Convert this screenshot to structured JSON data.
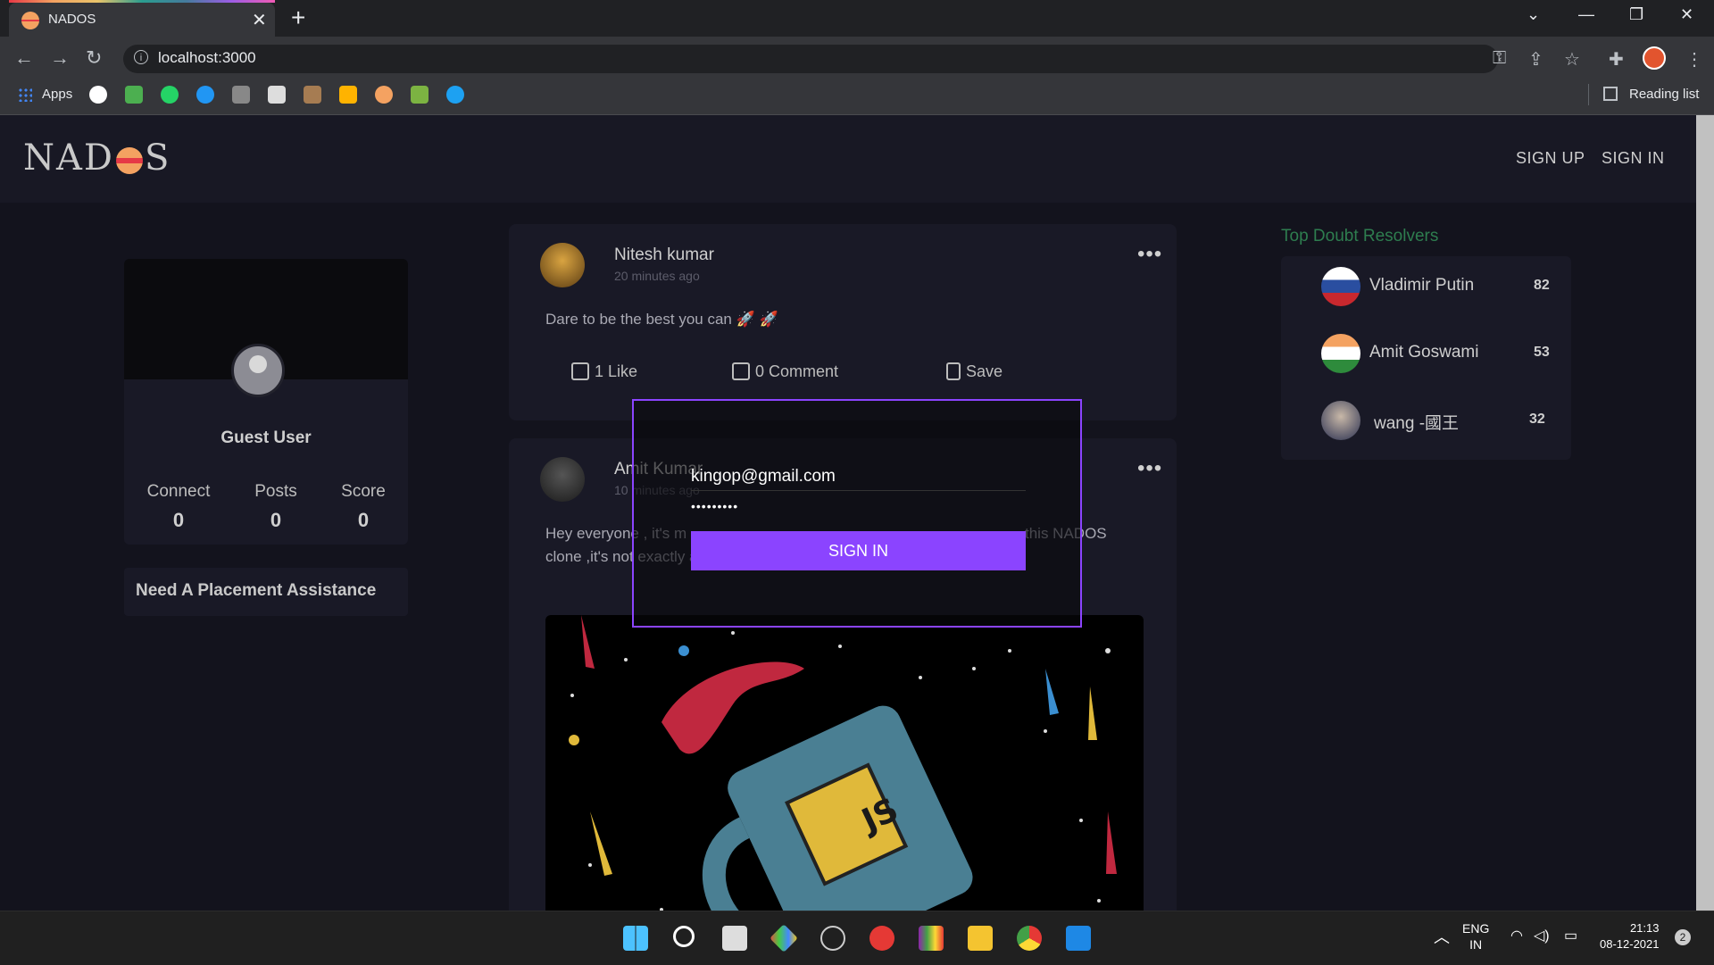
{
  "browser": {
    "tab_title": "NADOS",
    "url": "localhost:3000",
    "apps_label": "Apps",
    "reading_list": "Reading list",
    "win_minimize": "—",
    "win_restore": "❐",
    "win_close": "✕",
    "new_tab": "+",
    "tab_close": "✕"
  },
  "nav": {
    "logo": "NADOS",
    "sign_up": "SIGN UP",
    "sign_in": "SIGN IN"
  },
  "profile": {
    "name": "Guest User",
    "stats": [
      {
        "label": "Connect",
        "value": "0"
      },
      {
        "label": "Posts",
        "value": "0"
      },
      {
        "label": "Score",
        "value": "0"
      }
    ],
    "placement": "Need A Placement Assistance"
  },
  "posts": [
    {
      "author": "Nitesh kumar",
      "time": "20 minutes ago",
      "text": "Dare to be the best you can 🚀 🚀",
      "like": "1 Like",
      "comment": "0 Comment",
      "save": "Save"
    },
    {
      "author": "Amit Kumar",
      "time": "10 minutes ago",
      "text_line1": "Hey everyone , it's m",
      "text_line1b": "this NADOS",
      "text_line2": "clone ,it's not exactly as same as original one but i tried ... 🚀 🚀",
      "image_label": "JS"
    }
  ],
  "resolvers": {
    "title": "Top Doubt Resolvers",
    "items": [
      {
        "name": "Vladimir Putin",
        "score": "82"
      },
      {
        "name": "Amit Goswami",
        "score": "53"
      },
      {
        "name": "wang -國王",
        "score": "32"
      }
    ]
  },
  "modal": {
    "email": "kingop@gmail.com",
    "password_mask": "•••••••••",
    "button": "SIGN IN"
  },
  "tray": {
    "lang1": "ENG",
    "lang2": "IN",
    "time": "21:13",
    "date": "08-12-2021",
    "notifications": "2"
  }
}
